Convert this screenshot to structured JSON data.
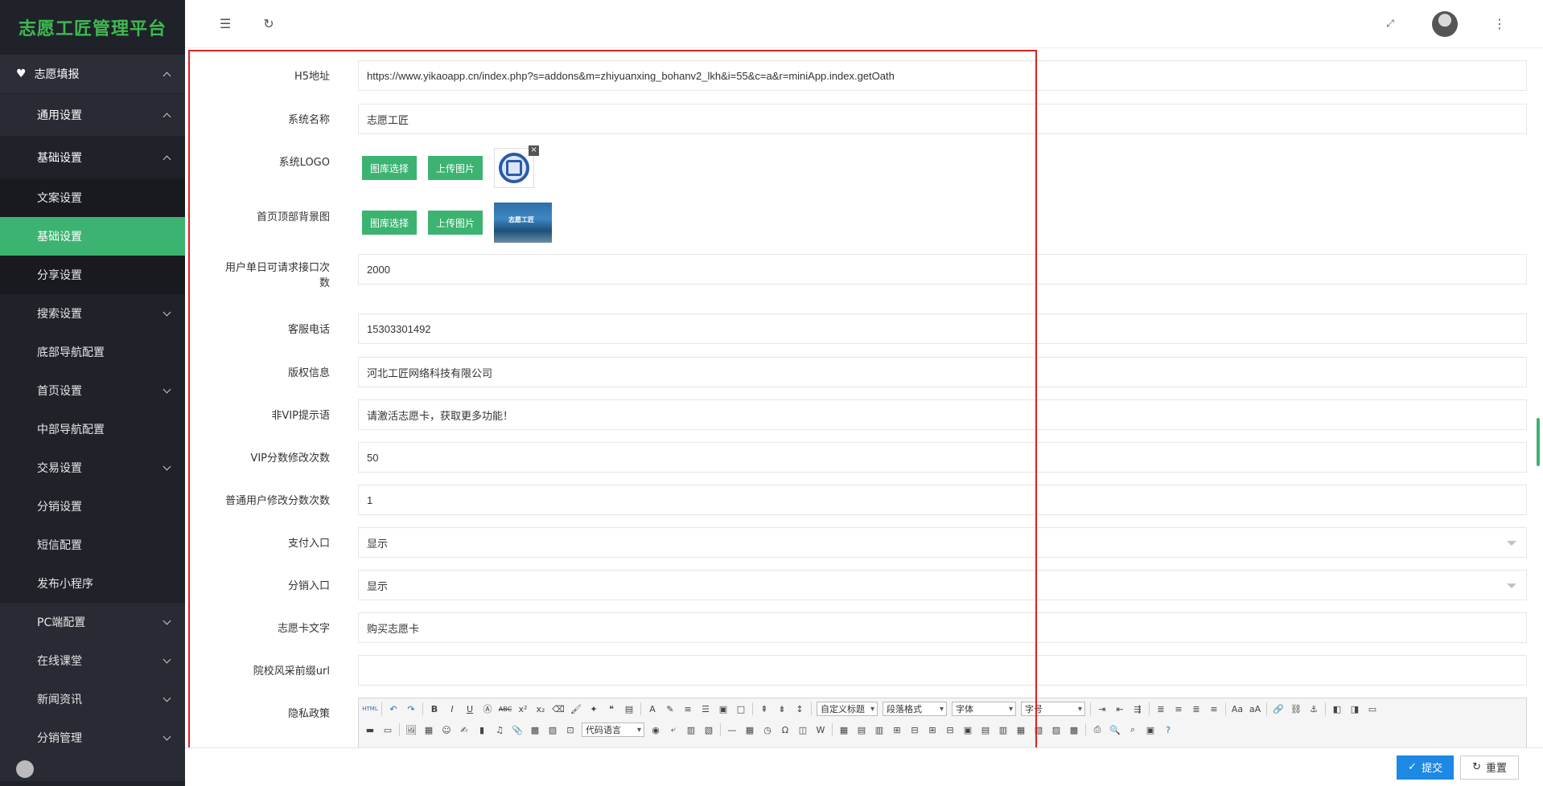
{
  "app": {
    "title": "志愿工匠管理平台"
  },
  "sidebar": {
    "top": {
      "label": "志愿填报",
      "icon": "heart-icon"
    },
    "general": {
      "label": "通用设置"
    },
    "basic": {
      "label": "基础设置"
    },
    "basic_items": [
      {
        "label": "文案设置"
      },
      {
        "label": "基础设置",
        "active": true
      },
      {
        "label": "分享设置"
      }
    ],
    "items": [
      {
        "label": "搜索设置",
        "expandable": true
      },
      {
        "label": "底部导航配置",
        "expandable": false
      },
      {
        "label": "首页设置",
        "expandable": true
      },
      {
        "label": "中部导航配置",
        "expandable": false
      },
      {
        "label": "交易设置",
        "expandable": true
      },
      {
        "label": "分销设置",
        "expandable": false
      },
      {
        "label": "短信配置",
        "expandable": false
      },
      {
        "label": "发布小程序",
        "expandable": false
      }
    ],
    "blocks": [
      {
        "label": "PC端配置"
      },
      {
        "label": "在线课堂"
      },
      {
        "label": "新闻资讯"
      },
      {
        "label": "分销管理"
      }
    ]
  },
  "header": {
    "menu_icon": "menu-fold-icon",
    "refresh_icon": "refresh-icon",
    "fullscreen_icon": "fullscreen-icon",
    "more_icon": "more-vertical-icon"
  },
  "form": {
    "h5": {
      "label": "H5地址",
      "value": "https://www.yikaoapp.cn/index.php?s=addons&m=zhiyuanxing_bohanv2_lkh&i=55&c=a&r=miniApp.index.getOath"
    },
    "name": {
      "label": "系统名称",
      "value": "志愿工匠"
    },
    "logo": {
      "label": "系统LOGO",
      "btn_gallery": "图库选择",
      "btn_upload": "上传图片"
    },
    "topbg": {
      "label": "首页顶部背景图",
      "btn_gallery": "图库选择",
      "btn_upload": "上传图片",
      "thumb_text": "志愿工匠"
    },
    "daily": {
      "label1": "用户单日可请求接口次",
      "label2": "数",
      "value": "2000"
    },
    "phone": {
      "label": "客服电话",
      "value": "15303301492"
    },
    "copyright": {
      "label": "版权信息",
      "value": "河北工匠网络科技有限公司"
    },
    "nonvip": {
      "label": "非VIP提示语",
      "value": "请激活志愿卡，获取更多功能！"
    },
    "vip_times": {
      "label": "VIP分数修改次数",
      "value": "50"
    },
    "normal_times": {
      "label": "普通用户修改分数次数",
      "value": "1"
    },
    "pay": {
      "label": "支付入口",
      "value": "显示"
    },
    "dist": {
      "label": "分销入口",
      "value": "显示"
    },
    "card_text": {
      "label": "志愿卡文字",
      "value": "购买志愿卡"
    },
    "school_url": {
      "label": "院校风采前缀url",
      "value": ""
    },
    "privacy": {
      "label": "隐私政策"
    }
  },
  "editor": {
    "sel_custom_title": "自定义标题",
    "sel_paragraph": "段落格式",
    "sel_font": "字体",
    "sel_size": "字号",
    "sel_code": "代码语言"
  },
  "footer": {
    "submit": "提交",
    "reset": "重置"
  },
  "colors": {
    "accent": "#3cb371",
    "primary": "#1e88e5",
    "highlight": "#e02020",
    "sidebar": "#20222a"
  }
}
